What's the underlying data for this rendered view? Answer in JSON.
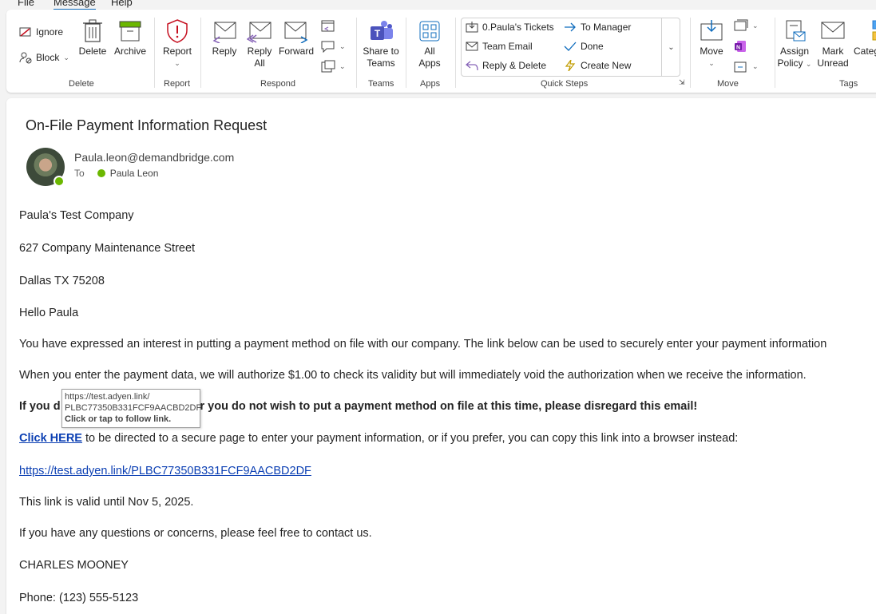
{
  "menu": {
    "tabs": [
      "File",
      "Message",
      "Help"
    ]
  },
  "ribbon": {
    "delete_group": {
      "label": "Delete",
      "ignore": "Ignore",
      "block": "Block",
      "delete": "Delete",
      "archive": "Archive"
    },
    "report_group": {
      "label": "Report",
      "report": "Report"
    },
    "respond_group": {
      "label": "Respond",
      "reply": "Reply",
      "reply_all_1": "Reply",
      "reply_all_2": "All",
      "forward": "Forward"
    },
    "teams_group": {
      "label": "Teams",
      "share_1": "Share to",
      "share_2": "Teams"
    },
    "apps_group": {
      "label": "Apps",
      "all_1": "All",
      "all_2": "Apps"
    },
    "quick_steps": {
      "label": "Quick Steps",
      "items": [
        "0.Paula's Tickets",
        "To Manager",
        "Team Email",
        "Done",
        "Reply & Delete",
        "Create New"
      ]
    },
    "move_group": {
      "label": "Move",
      "move": "Move"
    },
    "tags_group": {
      "label": "Tags",
      "assign_1": "Assign",
      "assign_2": "Policy",
      "mark_1": "Mark",
      "mark_2": "Unread",
      "categorize": "Categ"
    }
  },
  "email": {
    "subject": "On-File Payment Information Request",
    "sender": "Paula.leon@demandbridge.com",
    "to_label": "To",
    "to_name": "Paula Leon",
    "body": {
      "company": "Paula's Test Company",
      "street": "627 Company Maintenance Street",
      "city": "Dallas TX 75208",
      "greeting": "Hello Paula",
      "p1": "You have expressed an interest in putting a payment method on file with our company. The link below can be used to securely enter your payment information",
      "p2": "When you enter the payment data, we will authorize $1.00 to check its validity but will immediately void the authorization when we receive the information.",
      "p3_start": "If you d",
      "p3_end": ", or you do not wish to put a payment method on file at this time, please disregard this email!",
      "click_here": "Click HERE",
      "p4_rest": " to be directed to a secure page to enter your payment information, or if you prefer, you can copy this link into a browser instead:",
      "link": "https://test.adyen.link/PLBC77350B331FCF9AACBD2DF",
      "valid": "This link is valid until Nov 5, 2025.",
      "questions": "If you have any questions or concerns, please feel free to contact us.",
      "signature": "CHARLES MOONEY",
      "phone": "Phone: (123) 555-5123"
    }
  },
  "tooltip": {
    "line1": "https://test.adyen.link/",
    "line2": "PLBC77350B331FCF9AACBD2DF",
    "line3": "Click or tap to follow link."
  }
}
